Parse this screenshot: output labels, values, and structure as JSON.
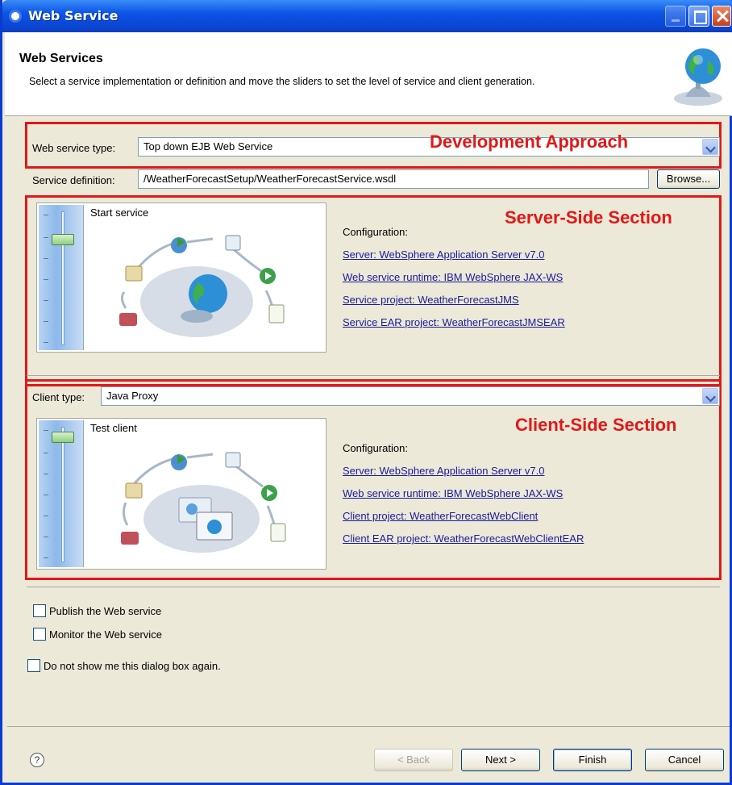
{
  "window": {
    "title": "Web Service"
  },
  "header": {
    "title": "Web Services",
    "description": "Select a service implementation or definition and move the sliders to set the level of service and client generation."
  },
  "service_type": {
    "label": "Web service type:",
    "value": "Top down EJB Web Service"
  },
  "service_definition": {
    "label": "Service definition:",
    "value": "/WeatherForecastSetup/WeatherForecastService.wsdl",
    "browse_label": "Browse..."
  },
  "annotations": {
    "development": "Development Approach",
    "server": "Server-Side Section",
    "client": "Client-Side Section"
  },
  "server_section": {
    "slider_title": "Start service",
    "slider_level": "Start service",
    "configuration_label": "Configuration:",
    "links": [
      "Server: WebSphere Application Server v7.0",
      "Web service runtime: IBM WebSphere JAX-WS",
      "Service project: WeatherForecastJMS",
      "Service EAR project: WeatherForecastJMSEAR"
    ]
  },
  "client_section": {
    "type_label": "Client type:",
    "type_value": "Java Proxy",
    "slider_title": "Test client",
    "slider_level": "Test client",
    "configuration_label": "Configuration:",
    "links": [
      "Server: WebSphere Application Server v7.0",
      "Web service runtime: IBM WebSphere JAX-WS",
      "Client project: WeatherForecastWebClient",
      "Client EAR project: WeatherForecastWebClientEAR"
    ]
  },
  "options": {
    "publish": {
      "label": "Publish the Web service",
      "checked": false
    },
    "monitor": {
      "label": "Monitor the Web service",
      "checked": false
    },
    "dont_show": {
      "label": "Do not show me this dialog box again.",
      "checked": false
    }
  },
  "buttons": {
    "back": "< Back",
    "next": "Next >",
    "finish": "Finish",
    "cancel": "Cancel"
  },
  "colors": {
    "title_bar": "#0a47d4",
    "annotation_red": "#e21818",
    "link": "#1a1a9a"
  },
  "icons": [
    "app-icon",
    "globe-icon",
    "help-icon",
    "chevron-down-icon"
  ]
}
